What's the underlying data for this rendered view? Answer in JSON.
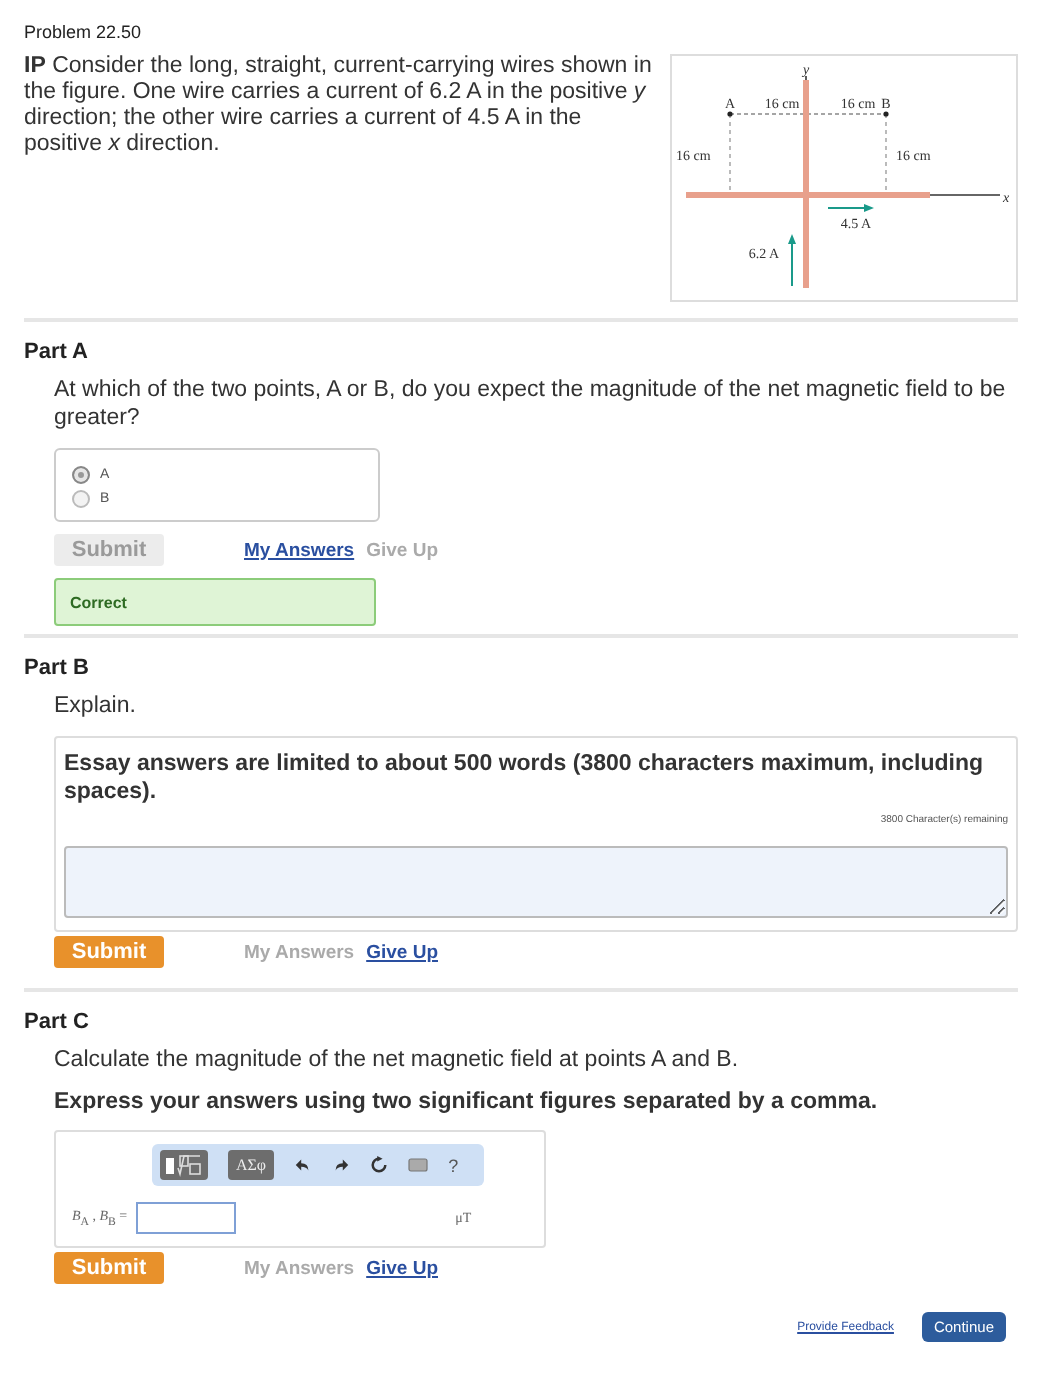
{
  "problem": {
    "title": "Problem 22.50",
    "intro": "**IP** Consider the long, straight, current-carrying wires shown in the figure. One wire carries a current of 6.2 A in the positive *y* direction; the other wire carries a current of 4.5 A in the positive *x* direction."
  },
  "figure": {
    "labels": [
      {
        "kind": "axis_y",
        "text": "y"
      },
      {
        "kind": "point_a",
        "text": "A"
      },
      {
        "kind": "top_left",
        "text": "16 cm"
      },
      {
        "kind": "top_right",
        "text": "16 cm"
      },
      {
        "kind": "point_b",
        "text": "B"
      },
      {
        "kind": "side_left",
        "text": "16 cm"
      },
      {
        "kind": "side_right",
        "text": "16 cm"
      },
      {
        "kind": "axis_x",
        "text": "x"
      },
      {
        "kind": "current_x",
        "text": "4.5 A"
      },
      {
        "kind": "current_y",
        "text": "6.2 A"
      }
    ]
  },
  "parts": [
    {
      "kind": "choice",
      "title": "Part A",
      "prompt": "At which of the two points, A or B, do you expect the magnitude of the net magnetic field to be greater?",
      "options": [
        {
          "label": "A",
          "selected": true
        },
        {
          "label": "B",
          "selected": false
        }
      ],
      "submit": {
        "label": "Submit",
        "disabled": true
      },
      "my_answers": {
        "label": "My Answers",
        "disabled": false
      },
      "give_up": {
        "label": "Give Up",
        "disabled": true
      },
      "feedback": "Correct"
    },
    {
      "kind": "essay",
      "title": "Part B",
      "prompt": "Explain.",
      "notice": "Essay answers are limited to about 500 words (3800 characters maximum, including spaces).",
      "counter": "3800 Character(s) remaining",
      "submit": {
        "label": "Submit",
        "disabled": false
      },
      "my_answers": {
        "label": "My Answers",
        "disabled": true
      },
      "give_up": {
        "label": "Give Up",
        "disabled": false
      }
    },
    {
      "kind": "numeric",
      "title": "Part C",
      "prompt": "Calculate the magnitude of the net magnetic field at points A and B.",
      "instruction": "Express your answers using two significant figures separated by a comma.",
      "toolbar": [
        {
          "kind": "templates"
        },
        {
          "kind": "symbols",
          "text": "ΑΣφ"
        },
        {
          "kind": "undo"
        },
        {
          "kind": "redo"
        },
        {
          "kind": "reset"
        },
        {
          "kind": "keyboard"
        },
        {
          "kind": "help",
          "text": "?"
        }
      ],
      "label": "*B*$_{A}$ , *B*$_{B}$ =",
      "unit": "μT",
      "submit": {
        "label": "Submit",
        "disabled": false
      },
      "my_answers": {
        "label": "My Answers",
        "disabled": true
      },
      "give_up": {
        "label": "Give Up",
        "disabled": false
      }
    }
  ],
  "footer": {
    "feedback_link": "Provide Feedback",
    "continue": "Continue"
  }
}
